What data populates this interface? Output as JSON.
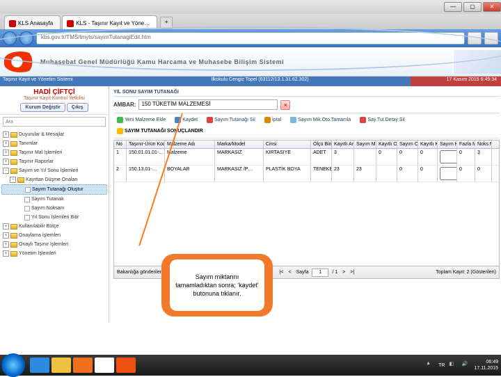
{
  "window": {
    "minimize": "—",
    "maximize": "▢",
    "close": "✕"
  },
  "tabs": [
    {
      "label": "KLS Anasayfa",
      "active": false
    },
    {
      "label": "KLS - Taşınır Kayıt ve Yöne…",
      "active": true
    }
  ],
  "addr": "kbs.gov.tr/TMS/tmyts/sayimTutanagiEdit.htm",
  "banner_title": "Muhasebat Genel Müdürlüğü Kamu Harcama ve Muhasebe Bilişim Sistemi",
  "infobar": {
    "left": "Taşınır Kayıt ve Yönetim Sistemi",
    "mid": "İlkokulu Cengiz Topel (63112/13.1.31.62.302)",
    "right": "17 Kasım 2015 6:49:34"
  },
  "user": {
    "name": "HADİ ÇİFTÇİ",
    "role": "Taşınır Kayıt Kontrol Yetkilisi",
    "change": "Kurum Değiştir",
    "logout": "Çıkış"
  },
  "search_placeholder": "Ara",
  "tree": [
    {
      "d": 0,
      "t": "+",
      "ic": "folder",
      "label": "Duyurular & Mesajlar"
    },
    {
      "d": 0,
      "t": "+",
      "ic": "folder",
      "label": "Tanımlar"
    },
    {
      "d": 0,
      "t": "+",
      "ic": "folder",
      "label": "Taşınır Mal İşlemleri"
    },
    {
      "d": 0,
      "t": "+",
      "ic": "folder",
      "label": "Taşınır Raporlar"
    },
    {
      "d": 0,
      "t": "−",
      "ic": "folder",
      "label": "Sayım ve Yıl Sonu İşlemleri"
    },
    {
      "d": 1,
      "t": "−",
      "ic": "folder",
      "label": "Kayıttan Düşme Onaları"
    },
    {
      "d": 2,
      "t": "",
      "ic": "leaf",
      "label": "Sayım Tutanağı Oluştur",
      "sel": true
    },
    {
      "d": 2,
      "t": "",
      "ic": "leaf",
      "label": "Sayım Tutanak"
    },
    {
      "d": 2,
      "t": "",
      "ic": "leaf",
      "label": "Sayım Noksanı"
    },
    {
      "d": 2,
      "t": "",
      "ic": "leaf",
      "label": "Yıl Sonu İşlemleri Bitir"
    },
    {
      "d": 0,
      "t": "+",
      "ic": "folder",
      "label": "Kullanılabilir Bütçe"
    },
    {
      "d": 0,
      "t": "+",
      "ic": "folder",
      "label": "Onaylama İşlemleri"
    },
    {
      "d": 0,
      "t": "+",
      "ic": "folder",
      "label": "Onaylı Taşınır İşlemleri"
    },
    {
      "d": 0,
      "t": "+",
      "ic": "folder",
      "label": "Yönetim İşlemleri"
    }
  ],
  "panel_head": "YIL SONU SAYIM TUTANAĞI",
  "ambar": {
    "label": "AMBAR:",
    "value": "150 TÜKETİM MALZEMESİ"
  },
  "toolbar": [
    {
      "ic": "ic-add",
      "label": "Yeni Malzeme Ekle"
    },
    {
      "ic": "ic-save",
      "label": "Kaydet"
    },
    {
      "ic": "ic-del",
      "label": "Sayım Tutanağı Sil"
    },
    {
      "ic": "ic-cancel",
      "label": "İptal"
    },
    {
      "ic": "ic-doc",
      "label": "Sayım Mik.Oto.Tamamla"
    },
    {
      "ic": "ic-del",
      "label": "Say.Tut.Detay Sil"
    },
    {
      "ic": "ic-star",
      "label": "SAYIM TUTANAĞI SONUÇLANDIR",
      "last": true
    }
  ],
  "grid_headers": [
    "No",
    "Taşınır-Ürün Kodu",
    "Malzeme Adı",
    "Marka/Model",
    "Cinsi",
    "Ölçü Birimi",
    "Kayıtlı Ambar Miktarı",
    "Sayım Miktarı",
    "Kayıtlı Ortak Zimmet",
    "Sayım Ortak Zimmet",
    "Kayıtlı Kişiye Zimmet",
    "Sayım Kişi Miktarı",
    "Fazla Miktar",
    "Noks Mik"
  ],
  "grid_rows": [
    {
      "no": "1",
      "kod": "150.01.01.01-…",
      "ad": "Malzeme",
      "marka": "MARKASIZ",
      "cins": "KIRTASIYE",
      "olcu": "ADET",
      "kayit": "3",
      "sayim": "",
      "kortak": "0",
      "sortak": "0",
      "kkisi": "0",
      "skisi": "",
      "fazla": "0",
      "noks": "3"
    },
    {
      "no": "2",
      "kod": "150.13.01-…",
      "ad": "BOYALAR",
      "marka": "MARKASIZ /P…",
      "cins": "PLASTİK BOYA",
      "olcu": "TENEKE",
      "kayit": "23",
      "sayim": "23",
      "kortak": "",
      "sortak": "0",
      "kkisi": "0",
      "skisi": "",
      "fazla": "0",
      "noks": "0"
    }
  ],
  "footer": {
    "upload": "Bakanlığa gönderilen Dosya Yükleme",
    "page_lbl": "Sayfa",
    "page": "1",
    "of": "/ 1",
    "total": "Toplam Kayıt: 2 (Gösterilen)"
  },
  "bubble": "Sayım miktarını tamamladıktan sonra; ‘kaydet’ butonuna tıklanır.",
  "tray": {
    "lang": "TR",
    "time": "06:49",
    "date": "17.11.2015"
  }
}
